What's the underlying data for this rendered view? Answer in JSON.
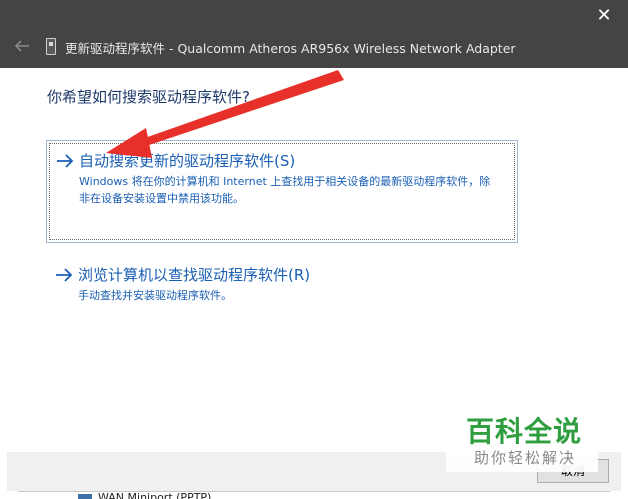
{
  "window": {
    "title": "更新驱动程序软件 - Qualcomm Atheros AR956x Wireless Network Adapter",
    "close_glyph": "✕"
  },
  "main": {
    "heading": "你希望如何搜索驱动程序软件?",
    "options": [
      {
        "title": "自动搜索更新的驱动程序软件(S)",
        "description": "Windows 将在你的计算机和 Internet 上查找用于相关设备的最新驱动程序软件，除非在设备安装设置中禁用该功能。"
      },
      {
        "title": "浏览计算机以查找驱动程序软件(R)",
        "description": "手动查找并安装驱动程序软件。"
      }
    ]
  },
  "footer": {
    "cancel_label": "取消"
  },
  "background_window": {
    "item_text": "WAN Miniport (PPTP)"
  },
  "watermark": {
    "main": "百科全说",
    "sub": "助你轻松解决"
  },
  "colors": {
    "titlebar": "#444444",
    "link_blue": "#1a5fb4",
    "heading_blue": "#1e3a6a",
    "annotation_red": "#e8302a",
    "watermark_green": "#2e9e3e"
  },
  "icons": {
    "back": "back-arrow-icon",
    "device": "network-adapter-icon",
    "option_arrow": "right-arrow-icon"
  }
}
